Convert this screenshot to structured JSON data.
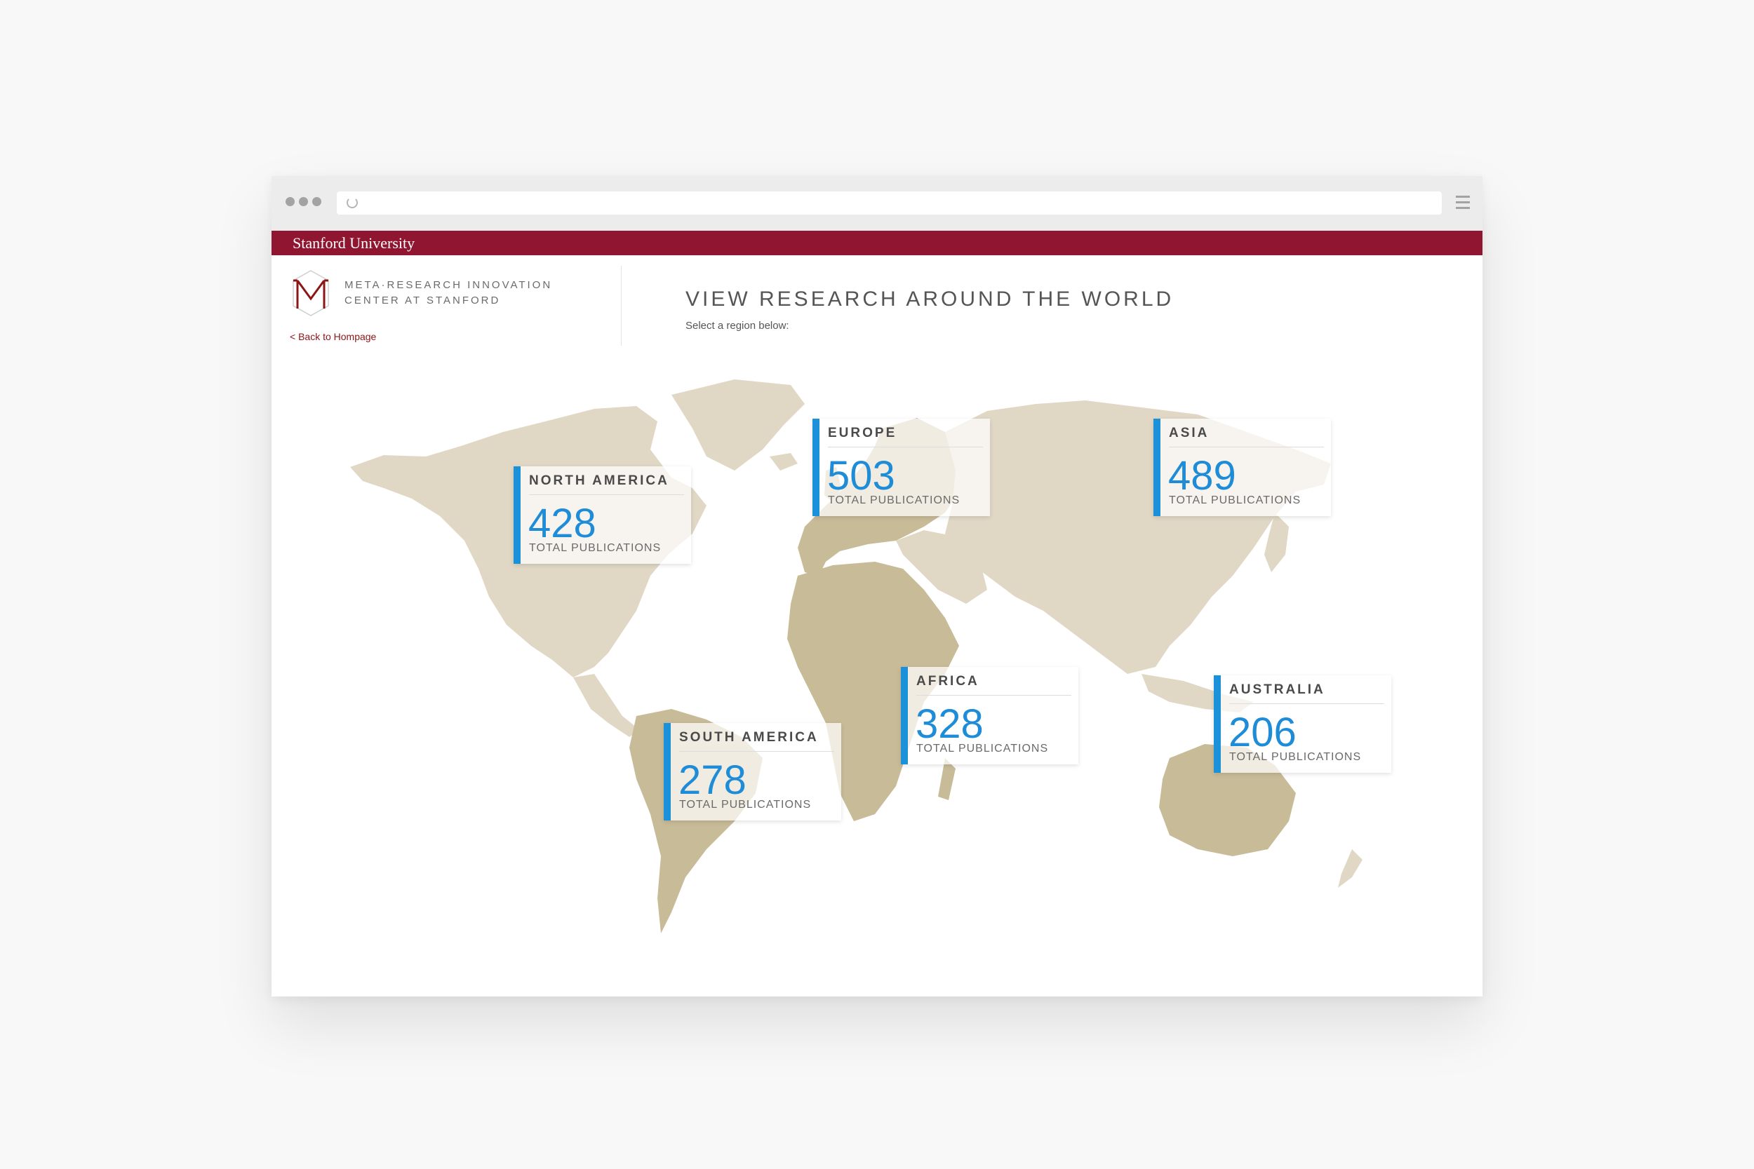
{
  "brand": {
    "university": "Stanford University",
    "center_line1": "META·RESEARCH INNOVATION",
    "center_line2": "CENTER AT STANFORD",
    "back_link": "< Back to Hompage",
    "accent_color": "#8f1530"
  },
  "page": {
    "title": "VIEW RESEARCH AROUND THE WORLD",
    "subtitle": "Select a region below:"
  },
  "colors": {
    "map_land": "#e0d8c5",
    "map_highlight": "#c8bb98",
    "card_accent": "#1a91d9",
    "count_text": "#1e8cd6"
  },
  "regions": [
    {
      "name": "NORTH AMERICA",
      "count": "428",
      "label": "TOTAL PUBLICATIONS",
      "highlighted": false
    },
    {
      "name": "EUROPE",
      "count": "503",
      "label": "TOTAL PUBLICATIONS",
      "highlighted": true
    },
    {
      "name": "ASIA",
      "count": "489",
      "label": "TOTAL PUBLICATIONS",
      "highlighted": false
    },
    {
      "name": "SOUTH AMERICA",
      "count": "278",
      "label": "TOTAL PUBLICATIONS",
      "highlighted": true
    },
    {
      "name": "AFRICA",
      "count": "328",
      "label": "TOTAL PUBLICATIONS",
      "highlighted": true
    },
    {
      "name": "AUSTRALIA",
      "count": "206",
      "label": "TOTAL PUBLICATIONS",
      "highlighted": true
    }
  ]
}
